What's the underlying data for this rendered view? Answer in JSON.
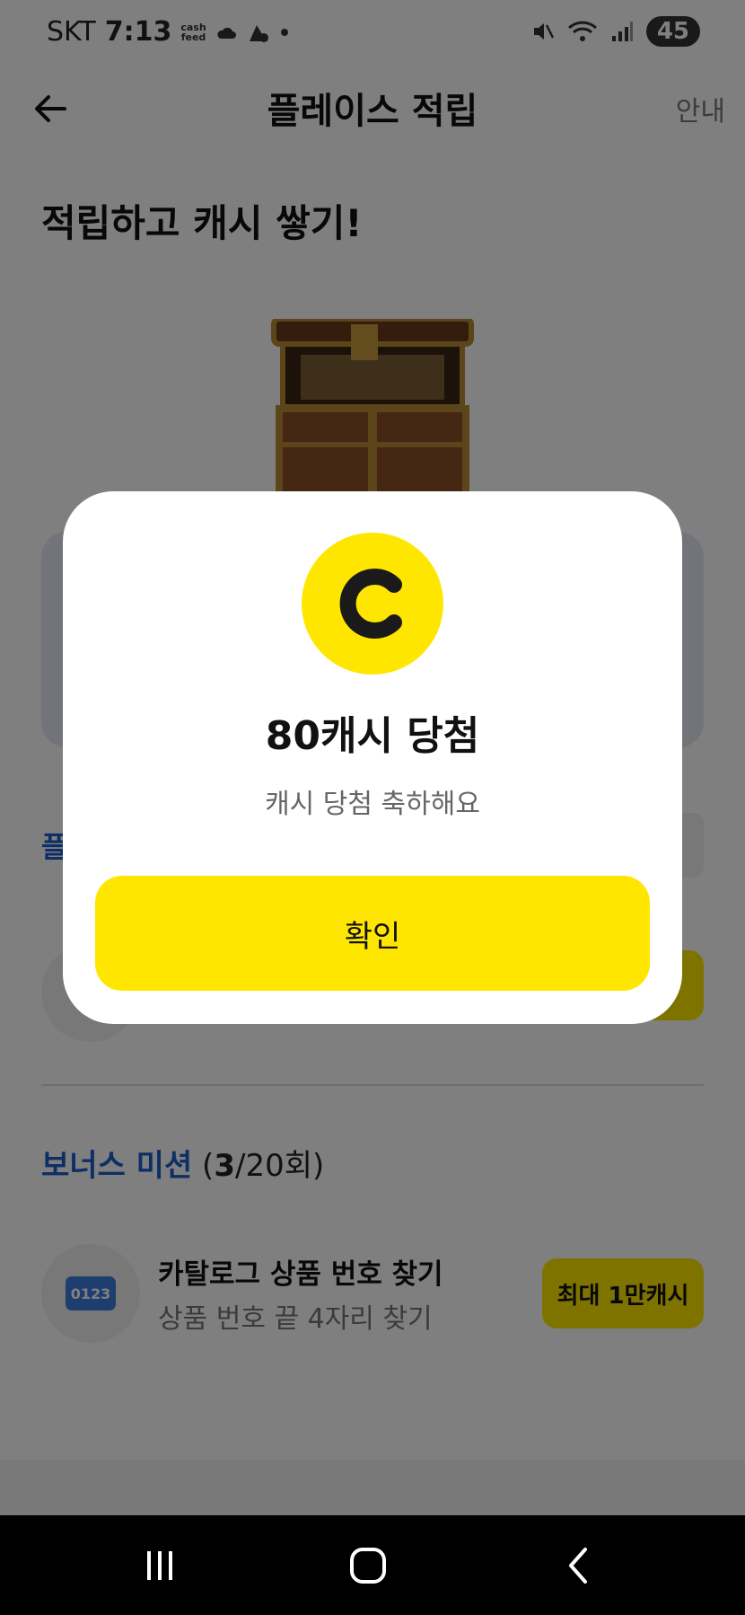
{
  "status_bar": {
    "carrier": "SKT",
    "time": "7:13",
    "cashfeed_top": "cash",
    "cashfeed_bottom": "feed",
    "battery": "45"
  },
  "header": {
    "title": "플레이스 적립",
    "info_label": "안내"
  },
  "hero": {
    "title": "적립하고 캐시 쌓기!"
  },
  "place_section": {
    "label": "플"
  },
  "bonus": {
    "title": "보너스 미션",
    "count_open": " (",
    "count_done": "3",
    "count_rest": "/20회)"
  },
  "mission": {
    "badge": "0123",
    "title": "카탈로그 상품 번호 찾기",
    "subtitle": "상품 번호 끝 4자리 찾기",
    "reward": "최대 1만캐시"
  },
  "modal": {
    "title": "80캐시 당첨",
    "subtitle": "캐시 당첨 축하해요",
    "confirm_label": "확인"
  },
  "colors": {
    "accent_yellow": "#ffe600",
    "accent_blue": "#1c5fc9",
    "overlay": "rgba(0,0,0,0.5)"
  },
  "icons": [
    "back-arrow-icon",
    "mute-icon",
    "wifi-icon",
    "signal-icon",
    "coin-c-icon",
    "treasure-chest-icon",
    "recent-apps-icon",
    "home-icon",
    "back-nav-icon"
  ]
}
